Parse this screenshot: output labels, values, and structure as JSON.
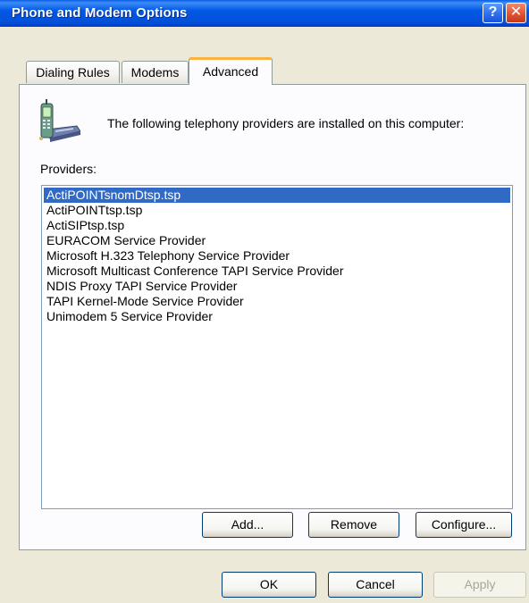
{
  "window": {
    "title": "Phone and Modem Options",
    "help_glyph": "?",
    "close_glyph": "✕"
  },
  "tabs": [
    {
      "label": "Dialing Rules",
      "active": false
    },
    {
      "label": "Modems",
      "active": false
    },
    {
      "label": "Advanced",
      "active": true
    }
  ],
  "advanced": {
    "intro_text": "The following telephony providers are installed on this computer:",
    "providers_label": "Providers:",
    "providers": [
      "ActiPOINTsnomDtsp.tsp",
      "ActiPOINTtsp.tsp",
      "ActiSIPtsp.tsp",
      "EURACOM Service Provider",
      "Microsoft H.323 Telephony Service Provider",
      "Microsoft Multicast Conference TAPI Service Provider",
      "NDIS Proxy TAPI Service Provider",
      "TAPI Kernel-Mode Service Provider",
      "Unimodem 5 Service Provider"
    ],
    "selected_index": 0,
    "add_label": "Add...",
    "remove_label": "Remove",
    "configure_label": "Configure..."
  },
  "footer": {
    "ok_label": "OK",
    "cancel_label": "Cancel",
    "apply_label": "Apply",
    "apply_enabled": false
  },
  "colors": {
    "selection": "#316ac5",
    "titlebar": "#0058e6",
    "dialog_face": "#ece9d8",
    "tab_highlight": "#f9b244"
  },
  "icons": {
    "title_help": "help-icon",
    "title_close": "close-icon",
    "header": "telephony-phone-icon"
  }
}
